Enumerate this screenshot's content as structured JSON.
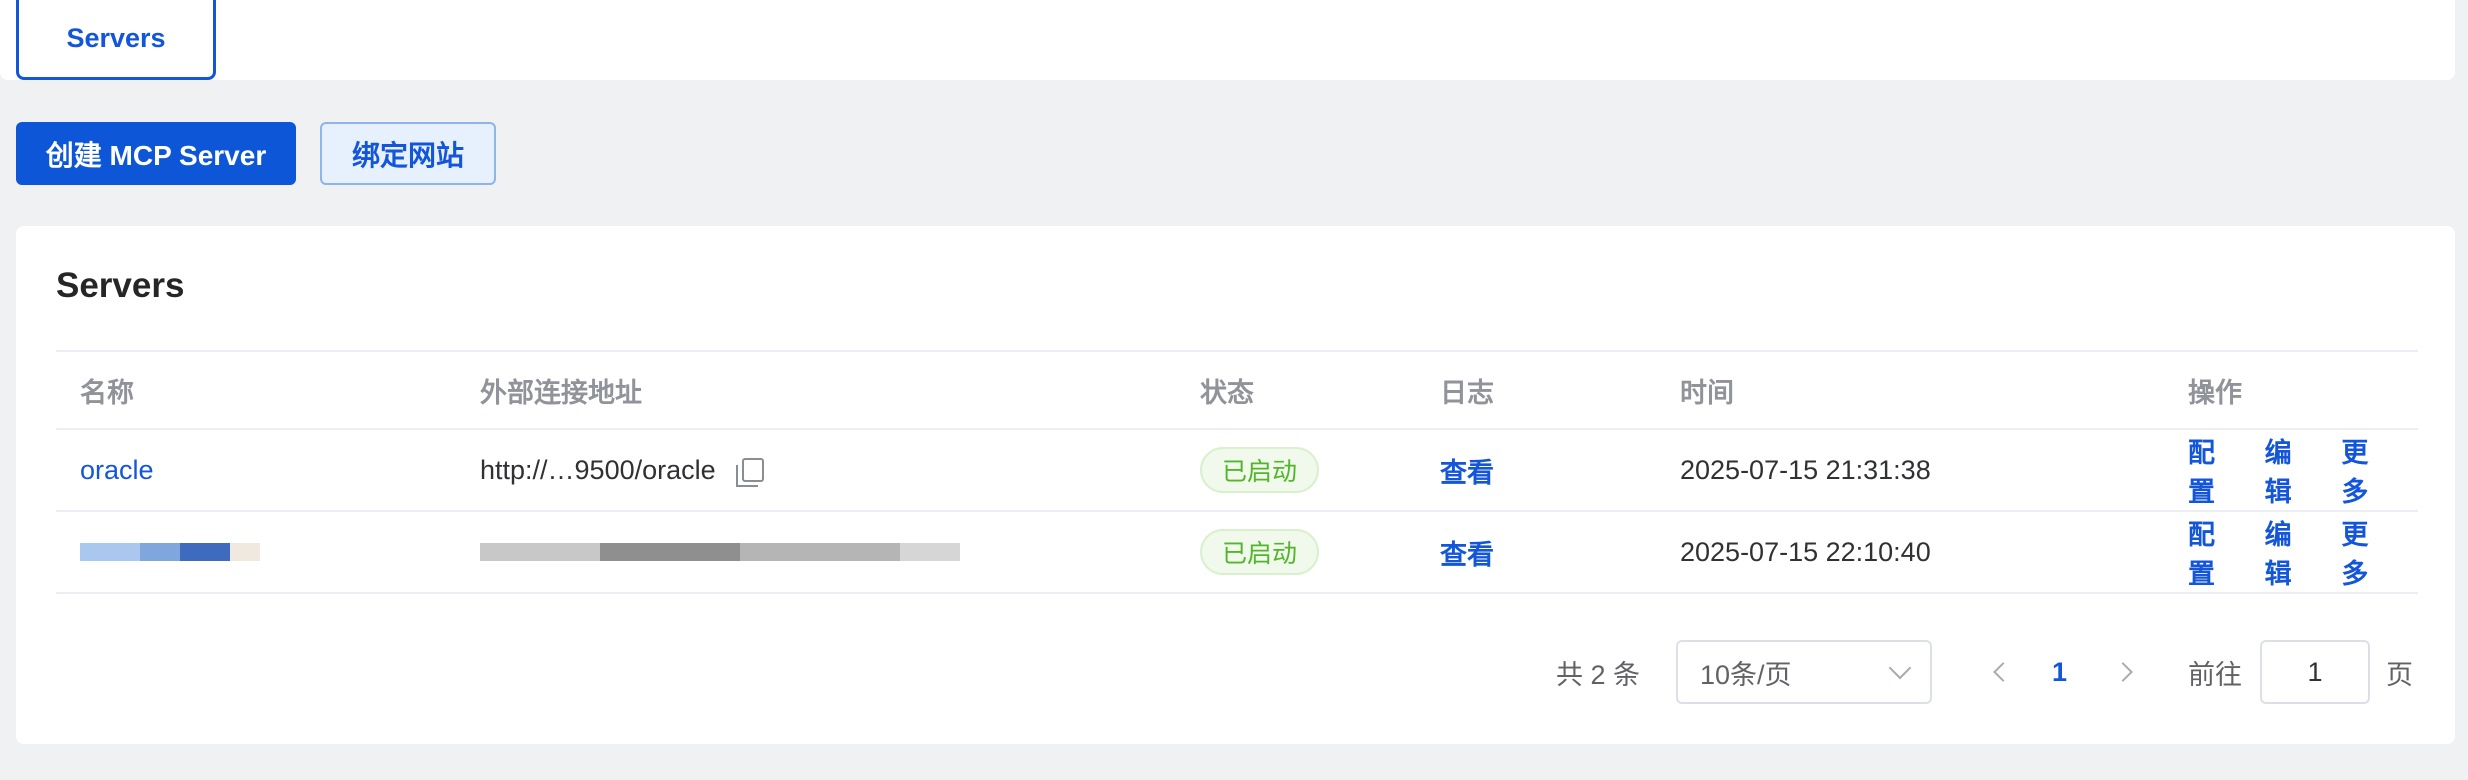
{
  "tabs": {
    "active_label": "Servers"
  },
  "toolbar": {
    "create_label": "创建 MCP Server",
    "bind_label": "绑定网站"
  },
  "card": {
    "title": "Servers"
  },
  "table": {
    "columns": [
      "名称",
      "外部连接地址",
      "状态",
      "日志",
      "时间",
      "操作"
    ],
    "rows": [
      {
        "name": "oracle",
        "url": "http://…9500/oracle",
        "status": "已启动",
        "log": "查看",
        "time": "2025-07-15 21:31:38",
        "ops": [
          "配置",
          "编辑",
          "更多"
        ]
      },
      {
        "name": "",
        "url": "",
        "status": "已启动",
        "log": "查看",
        "time": "2025-07-15 22:10:40",
        "ops": [
          "配置",
          "编辑",
          "更多"
        ]
      }
    ]
  },
  "pagination": {
    "total_text": "共 2 条",
    "page_size": "10条/页",
    "current_page": "1",
    "goto_label": "前往",
    "goto_value": "1",
    "page_suffix": "页"
  },
  "colors": {
    "primary": "#0d56d8",
    "success": "#52b62a",
    "background": "#f0f1f3"
  }
}
